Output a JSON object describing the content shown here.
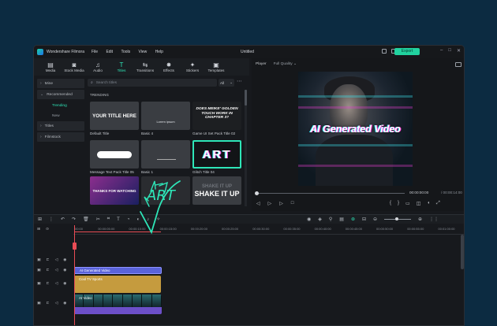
{
  "app": {
    "name": "Wondershare Filmora",
    "doc_title": "Untitled",
    "export_label": "Export"
  },
  "menu": [
    "File",
    "Edit",
    "Tools",
    "View",
    "Help"
  ],
  "toolbar": [
    {
      "label": "Media",
      "icon": "media-icon",
      "glyph": "▤"
    },
    {
      "label": "Stock Media",
      "icon": "stock-media-icon",
      "glyph": "◙"
    },
    {
      "label": "Audio",
      "icon": "music-note-icon",
      "glyph": "♫"
    },
    {
      "label": "Titles",
      "icon": "titles-icon",
      "glyph": "T",
      "active": true
    },
    {
      "label": "Transitions",
      "icon": "transitions-icon",
      "glyph": "⇆"
    },
    {
      "label": "Effects",
      "icon": "effects-icon",
      "glyph": "✸"
    },
    {
      "label": "Stickers",
      "icon": "stickers-icon",
      "glyph": "✦"
    },
    {
      "label": "Templates",
      "icon": "templates-icon",
      "glyph": "▣"
    }
  ],
  "sidebar": {
    "mine": "Mine",
    "recommended": "Recommended",
    "trending": "Trending",
    "new": "New",
    "titles": "Titles",
    "filmstock": "Filmstock"
  },
  "search": {
    "placeholder": "Search titles",
    "filter": "All"
  },
  "section_label": "TRENDING",
  "cards": [
    {
      "label": "Default Title",
      "text": "YOUR TITLE HERE"
    },
    {
      "label": "Basic 4",
      "text": "Lorem ipsum"
    },
    {
      "label": "Game UI Set Pack Title 02",
      "text": "DOES MEIKE' GOLDEN TOUCH WORK IN CHAPTER 3?"
    },
    {
      "label": "Message Text Pack Title 05",
      "text": ""
    },
    {
      "label": "Basic 1",
      "text": ""
    },
    {
      "label": "Glitch Title 04",
      "text": "ART"
    },
    {
      "label": "",
      "text": "THANKS FOR WATCHING"
    },
    {
      "label": "",
      "text": ""
    },
    {
      "label": "",
      "text": "SHAKE IT UP"
    }
  ],
  "player": {
    "tab": "Player",
    "quality": "Full Quality",
    "video_text": "AI Generated Video",
    "current_time": "00:00:00:00",
    "total_time": "/ 00:00:14:00"
  },
  "ruler": [
    "00:00",
    "00:00:05:00",
    "00:00:10:00",
    "00:00:15:00",
    "00:00:20:00",
    "00:00:25:00",
    "00:00:30:00",
    "00:00:35:00",
    "00:00:40:00",
    "00:00:45:00",
    "00:00:50:00",
    "00:00:55:00",
    "00:01:00:00"
  ],
  "clips": {
    "title": "AI Generated Video",
    "audio": "Cool TV Sports",
    "video": "AI Video"
  },
  "annotation": {
    "text": "ART",
    "color": "#2ee6b8"
  }
}
